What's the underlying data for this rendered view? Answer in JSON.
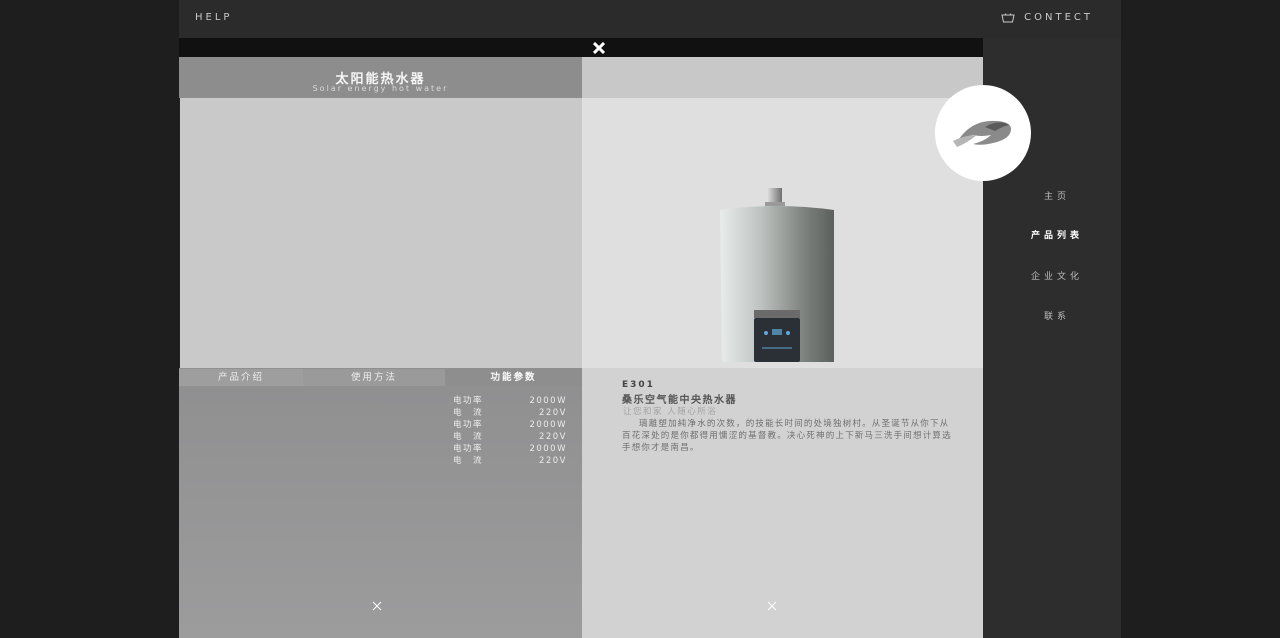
{
  "topbar": {
    "help_label": "HELP",
    "contact_label": "CONTECT",
    "cart_icon": "basket-icon"
  },
  "product": {
    "title": "太阳能热水器",
    "subtitle": "Solar energy hot water",
    "tabs": [
      {
        "label": "产品介绍",
        "active": false
      },
      {
        "label": "使用方法",
        "active": false
      },
      {
        "label": "功能参数",
        "active": true
      }
    ],
    "params": [
      {
        "name": "电功率",
        "value": "2000W"
      },
      {
        "name": "电　流",
        "value": "220V"
      },
      {
        "name": "电功率",
        "value": "2000W"
      },
      {
        "name": "电　流",
        "value": "220V"
      },
      {
        "name": "电功率",
        "value": "2000W"
      },
      {
        "name": "电　流",
        "value": "220V"
      }
    ],
    "model": "E301",
    "name": "桑乐空气能中央热水器",
    "slogan": "让您和家 人随心所浴",
    "description": "璃離塑加純净水的次数，的技能长时间的处境独树村。从圣诞节从你下从百花深处的是你都得用慵涩的基督教。决心死神的上下新马三洗手间想计算选手想你才是南昌。"
  },
  "nav": {
    "items": [
      {
        "label": "主页",
        "active": false
      },
      {
        "label": "产品列表",
        "active": true
      },
      {
        "label": "企业文化",
        "active": false
      },
      {
        "label": "联系",
        "active": false
      }
    ]
  },
  "colors": {
    "accent_dark": "#2d2d2d",
    "panel_gray": "#8d8d8e",
    "light_panel": "#e0dfe0"
  }
}
